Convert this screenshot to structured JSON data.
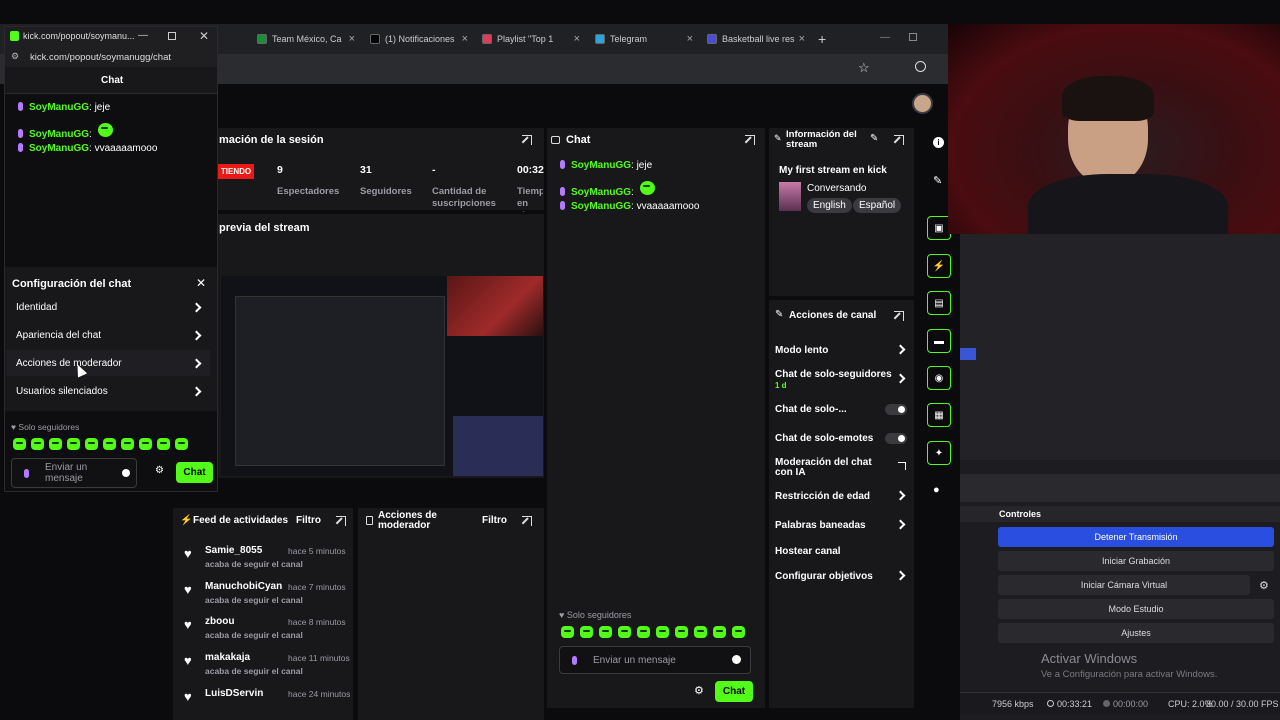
{
  "browser_tabs": [
    {
      "label": "Team México, Ca",
      "color": "#1a8f3a"
    },
    {
      "label": "(1) Notificaciones",
      "color": "#000"
    },
    {
      "label": "Playlist \"Top 1",
      "color": "#e13b5b"
    },
    {
      "label": "Telegram",
      "color": "#2aa3e0"
    },
    {
      "label": "Basketball live res",
      "color": "#4b4bd8"
    }
  ],
  "popup": {
    "title": "kick.com/popout/soymanu...",
    "url": "kick.com/popout/soymanugg/chat",
    "chat_title": "Chat",
    "messages": [
      {
        "user": "SoyManuGG",
        "text": ": jeje"
      },
      {
        "user": "SoyManuGG",
        "text": ":"
      },
      {
        "user": "SoyManuGG",
        "text": ": vvaaaaamooo"
      }
    ],
    "config_title": "Configuración del chat",
    "config_items": [
      "Identidad",
      "Apariencia del chat",
      "Acciones de moderador",
      "Usuarios silenciados"
    ],
    "followers_only": "Solo seguidores",
    "input_placeholder": "Enviar un mensaje",
    "send_label": "Chat"
  },
  "dashboard": {
    "session_title": "mación de la sesión",
    "live_badge": "TIENDO",
    "stats": [
      {
        "value": "9",
        "label": "Espectadores"
      },
      {
        "value": "31",
        "label": "Seguidores"
      },
      {
        "value": "-",
        "label": "Cantidad de suscripciones"
      },
      {
        "value": "00:32",
        "label": "Tiemp en viv"
      }
    ],
    "preview_title": "previa del stream",
    "activity": {
      "title": "Feed de actividades",
      "filter": "Filtro",
      "items": [
        {
          "user": "Samie_8055",
          "time": "hace 5 minutos",
          "action": "acaba de seguir el canal"
        },
        {
          "user": "ManuchobiCyan",
          "time": "hace 7 minutos",
          "action": "acaba de seguir el canal"
        },
        {
          "user": "zboou",
          "time": "hace 8 minutos",
          "action": "acaba de seguir el canal"
        },
        {
          "user": "makakaja",
          "time": "hace 11 minutos",
          "action": "acaba de seguir el canal"
        },
        {
          "user": "LuisDServin",
          "time": "hace 24 minutos",
          "action": ""
        }
      ]
    },
    "mod_actions": {
      "title": "Acciones de moderador",
      "filter": "Filtro"
    },
    "chat": {
      "title": "Chat",
      "messages": [
        {
          "user": "SoyManuGG",
          "text": ": jeje"
        },
        {
          "user": "SoyManuGG",
          "text": ":"
        },
        {
          "user": "SoyManuGG",
          "text": ": vvaaaaamooo"
        }
      ],
      "followers_only": "Solo seguidores",
      "input_placeholder": "Enviar un mensaje",
      "send_label": "Chat"
    },
    "stream_info": {
      "title": "Información del stream",
      "stream_name": "My first stream en kick",
      "category": "Conversando",
      "tags": [
        "English",
        "Español"
      ]
    },
    "channel_actions": {
      "title": "Acciones de canal",
      "slow_mode": "Modo lento",
      "followers_only": "Chat de solo-seguidores",
      "followers_duration": "1 d",
      "subs_only": "Chat de solo-...",
      "emotes_only": "Chat de solo-emotes",
      "ai_moderation": "Moderación del chat con IA",
      "age_restriction": "Restricción de edad",
      "banned_words": "Palabras baneadas",
      "host": "Hostear canal",
      "goals": "Configurar objetivos"
    }
  },
  "obs": {
    "controls_title": "Controles",
    "buttons": [
      "Detener Transmisión",
      "Iniciar Grabación",
      "Iniciar Cámara Virtual",
      "Modo Estudio",
      "Ajustes"
    ],
    "watermark_title": "Activar Windows",
    "watermark_sub": "Ve a Configuración para activar Windows.",
    "status": {
      "bitrate": "7956 kbps",
      "live_time": "00:33:21",
      "rec_time": "00:00:00",
      "cpu": "CPU: 2.0%",
      "fps": "30.00 / 30.00 FPS"
    }
  }
}
